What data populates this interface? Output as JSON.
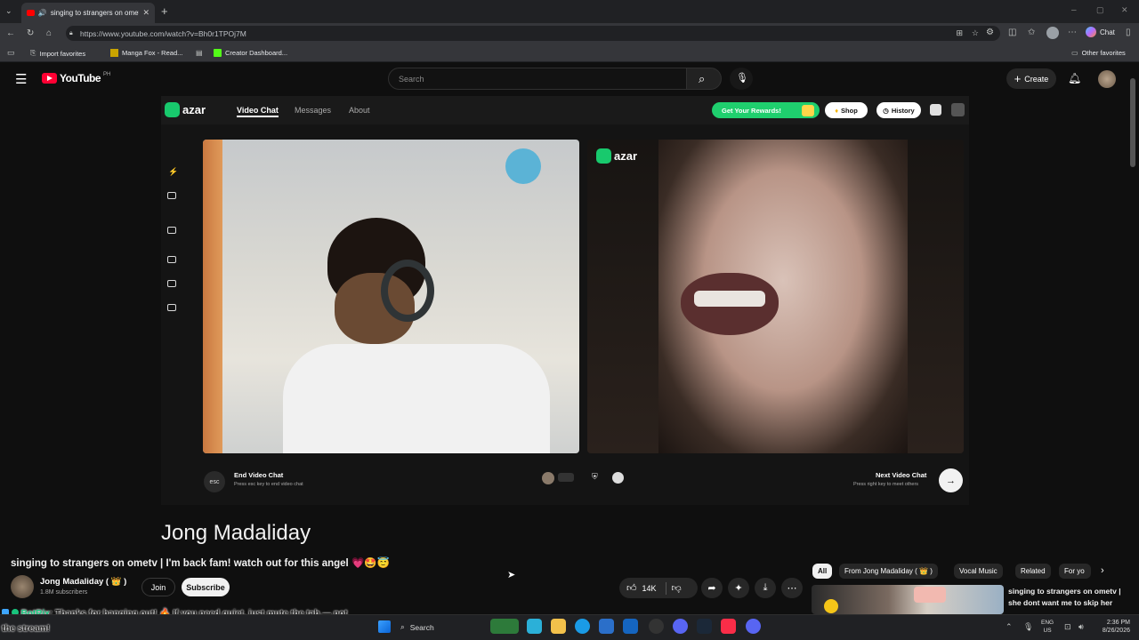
{
  "browser": {
    "tab_title": "singing to strangers on omet",
    "url": "https://www.youtube.com/watch?v=Bh0r1TPOj7M",
    "chat_label": "Chat",
    "favorites": [
      "Import favorites",
      "Manga Fox - Read...",
      "Creator Dashboard..."
    ],
    "other_favorites": "Other favorites"
  },
  "youtube": {
    "logo_text": "YouTube",
    "region": "PH",
    "search_placeholder": "Search",
    "create_label": "Create"
  },
  "azar": {
    "logo": "azar",
    "nav": [
      "Video Chat",
      "Messages",
      "About"
    ],
    "rewards_label": "Get Your Rewards!",
    "shop_label": "Shop",
    "history_label": "History",
    "end_key": "esc",
    "end_title": "End Video Chat",
    "end_sub": "Press esc key to end video chat",
    "next_title": "Next Video Chat",
    "next_sub": "Press right key to meet others"
  },
  "channel_overlay_name": "Jong Madaliday",
  "video": {
    "title": "singing to strangers on ometv | I'm back fam! watch out for this angel 💗🤩😇",
    "channel": "Jong Madaliday ( 👑 )",
    "subscribers": "1.8M subscribers",
    "join_label": "Join",
    "subscribe_label": "Subscribe",
    "likes": "14K"
  },
  "chips": [
    "All",
    "From Jong Madaliday ( 👑 )",
    "Vocal Music",
    "Related",
    "For yo"
  ],
  "related": {
    "title_line1": "singing to strangers on ometv |",
    "title_line2": "she dont want me to skip her"
  },
  "chat_overlay": {
    "user": "BotRix",
    "message": ": Thanks for hanging out! 🔥 If you need quiet, just mute the tab — not",
    "message_cont": "the stream!"
  },
  "taskbar": {
    "search_label": "Search",
    "lang1": "ENG",
    "lang2": "US",
    "time": "2:36 PM",
    "date": "8/26/2026"
  }
}
